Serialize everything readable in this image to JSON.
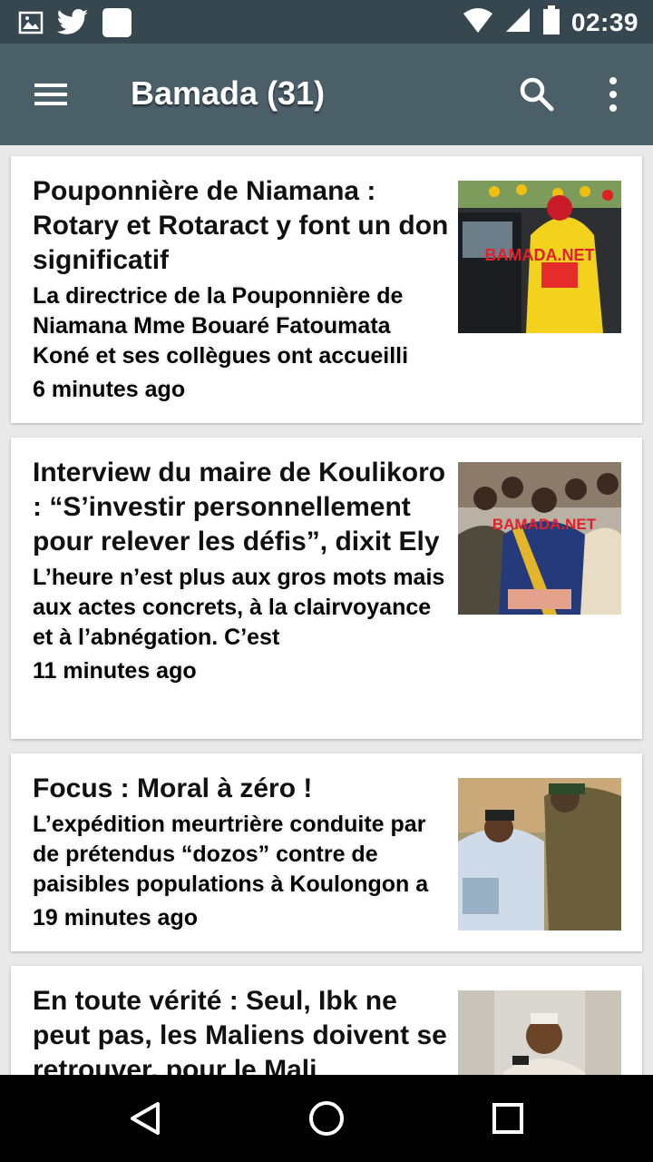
{
  "status_bar": {
    "time": "02:39",
    "left_icons": [
      "image-icon",
      "twitter-icon",
      "app-square-icon"
    ],
    "right_icons": [
      "wifi-icon",
      "signal-icon",
      "battery-icon"
    ]
  },
  "app_bar": {
    "title": "Bamada (31)",
    "menu_icon": "menu-icon",
    "search_icon": "search-icon",
    "overflow_icon": "overflow-menu-icon"
  },
  "articles": [
    {
      "headline": "Pouponnière de Niamana : Rotary et Rotaract y font un don significatif",
      "excerpt": "La directrice de la Pouponnière de Niamana Mme Bouaré Fatoumata Koné et ses collègues ont accueilli",
      "time": "6 minutes ago",
      "watermark": "BAMADA.NET"
    },
    {
      "headline": "Interview du maire de Koulikoro : “S’investir personnellement pour relever les défis”, dixit Ely",
      "excerpt": "L’heure n’est plus aux gros mots mais aux actes concrets, à la clairvoyance et à l’abnégation. C’est",
      "time": "11 minutes ago",
      "watermark": "BAMADA.NET"
    },
    {
      "headline": "Focus : Moral à zéro !",
      "excerpt": "L’expédition meurtrière conduite par de prétendus “dozos” contre de paisibles populations à Koulongon a",
      "time": "19 minutes ago",
      "watermark": ""
    },
    {
      "headline": "En toute vérité : Seul, Ibk ne peut pas, les Maliens doivent se retrouver, pour le Mali",
      "excerpt": "",
      "time": "",
      "watermark": ""
    }
  ],
  "nav_bar": {
    "back_icon": "back-icon",
    "home_icon": "home-icon",
    "recents_icon": "recents-icon"
  },
  "colors": {
    "status_bar": "#37474f",
    "app_bar": "#4b5f69",
    "background": "#e9e9e9",
    "watermark": "#e0202a"
  }
}
